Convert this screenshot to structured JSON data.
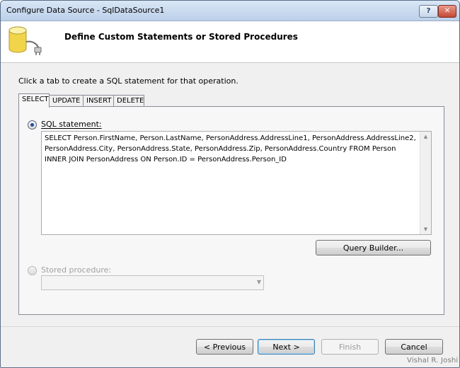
{
  "window": {
    "title": "Configure Data Source - SqlDataSource1",
    "help_label": "?",
    "close_label": "✕"
  },
  "header": {
    "title": "Define Custom Statements or Stored Procedures",
    "icon": "database-plug-icon"
  },
  "instruction": "Click a tab to create a SQL statement for that operation.",
  "tabs": [
    {
      "label": "SELECT",
      "active": true
    },
    {
      "label": "UPDATE",
      "active": false
    },
    {
      "label": "INSERT",
      "active": false
    },
    {
      "label": "DELETE",
      "active": false
    }
  ],
  "sql_option": {
    "label": "SQL statement:",
    "selected": true,
    "text": "SELECT Person.FirstName, Person.LastName, PersonAddress.AddressLine1, PersonAddress.AddressLine2, PersonAddress.City, PersonAddress.State, PersonAddress.Zip, PersonAddress.Country FROM Person INNER JOIN PersonAddress ON Person.ID = PersonAddress.Person_ID"
  },
  "query_builder_label": "Query Builder...",
  "stored_procedure": {
    "label": "Stored procedure:",
    "selected": false,
    "enabled": false,
    "value": ""
  },
  "footer": {
    "previous_label": "< Previous",
    "next_label": "Next >",
    "finish_label": "Finish",
    "cancel_label": "Cancel"
  },
  "watermark": "Vishal R. Joshi"
}
